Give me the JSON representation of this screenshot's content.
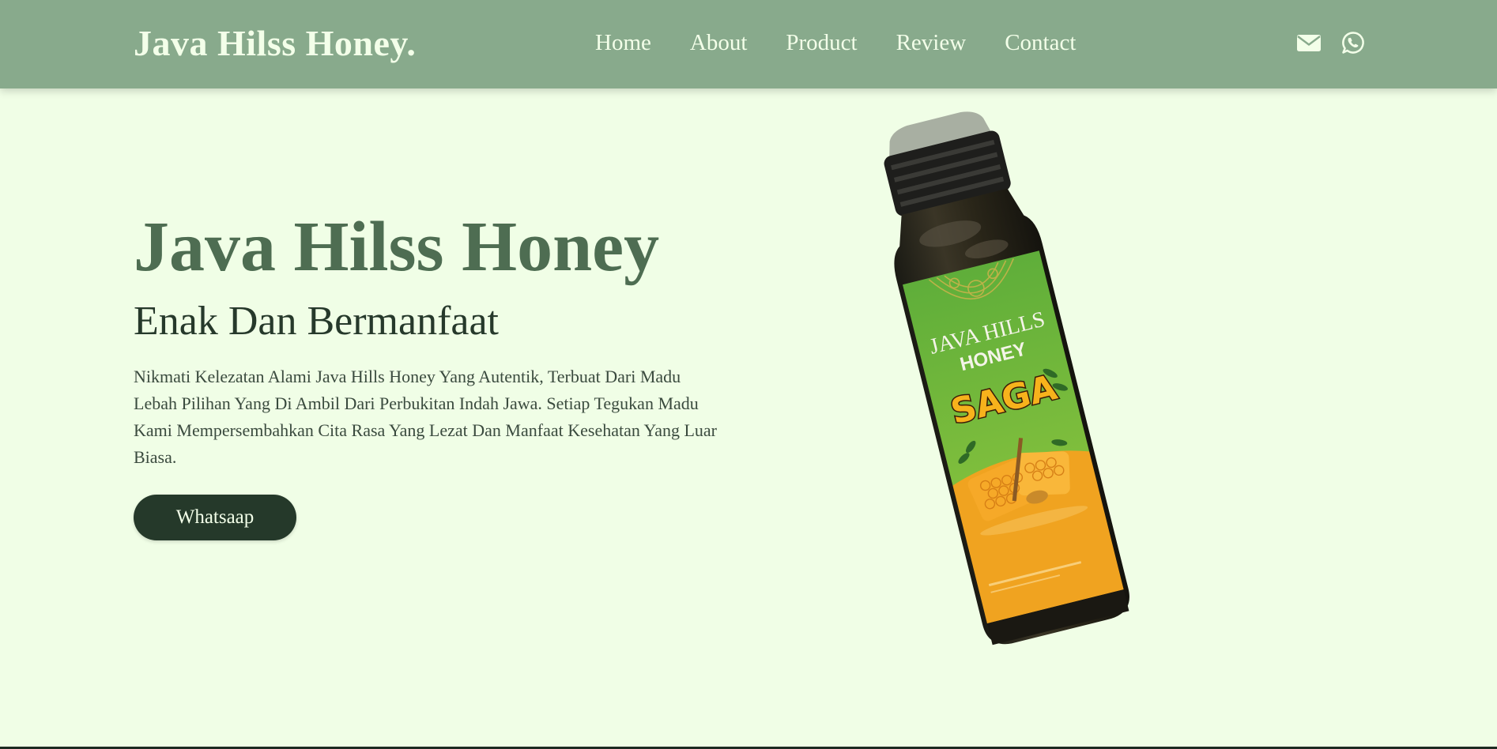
{
  "navbar": {
    "brand": "Java Hilss Honey.",
    "links": [
      "Home",
      "About",
      "Product",
      "Review",
      "Contact"
    ],
    "icons": [
      "envelope-icon",
      "whatsapp-icon"
    ]
  },
  "hero": {
    "title": "Java Hilss Honey",
    "subtitle": "Enak Dan Bermanfaat",
    "description": "Nikmati Kelezatan Alami Java Hills Honey Yang Autentik, Terbuat Dari Madu Lebah Pilihan Yang Di Ambil Dari Perbukitan Indah Jawa. Setiap Tegukan Madu Kami Mempersembahkan Cita Rasa Yang Lezat Dan Manfaat Kesehatan Yang Luar Biasa.",
    "button_label": "Whatsaap"
  },
  "product": {
    "label_line1": "JAVA HILLS",
    "label_line2": "HONEY",
    "label_name": "SAGA"
  },
  "colors": {
    "navbar_bg": "#88aa8c",
    "page_bg": "#f0fee6",
    "title": "#4e6d52",
    "button_bg": "#25392a",
    "light_text": "#f3ffe9"
  }
}
